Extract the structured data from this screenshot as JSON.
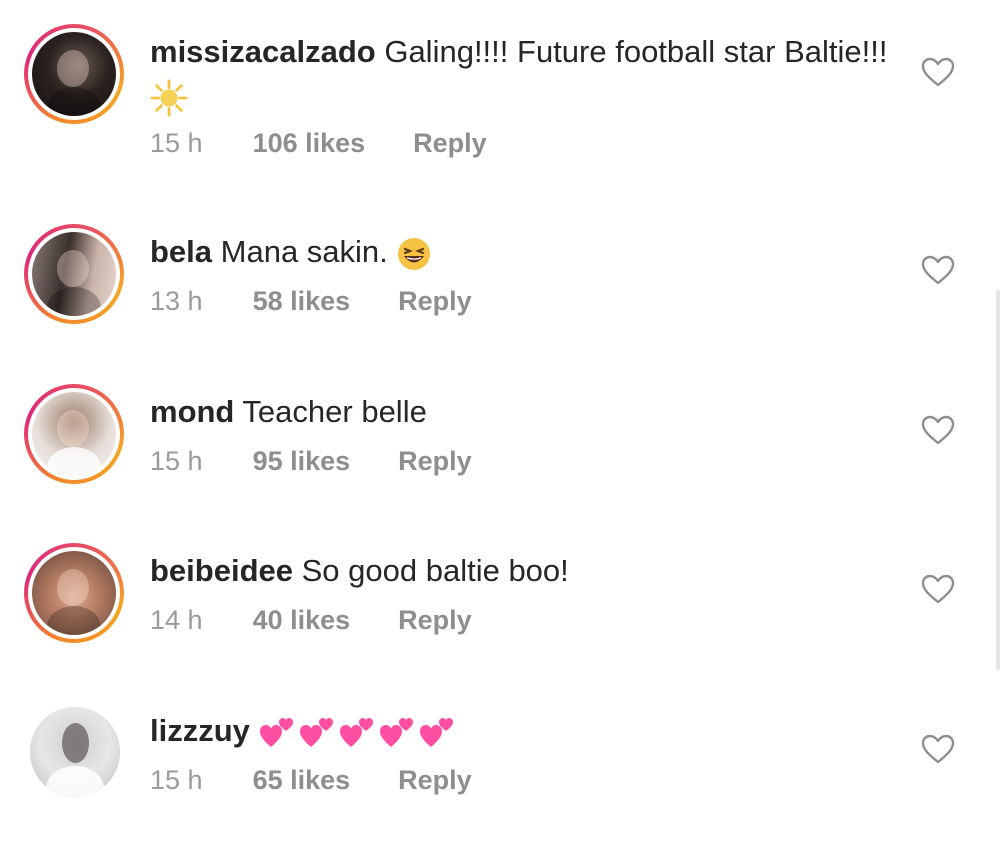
{
  "comments": [
    {
      "username": "missizacalzado",
      "text": " Galing!!!! Future football star Baltie!!! ",
      "emoji": "sun-emoji",
      "time": "15 h",
      "likes": "106 likes",
      "reply": "Reply",
      "avatar_ring": true
    },
    {
      "username": "bela",
      "text": " Mana sakin. ",
      "emoji": "laughing-emoji",
      "time": "13 h",
      "likes": "58 likes",
      "reply": "Reply",
      "avatar_ring": true
    },
    {
      "username": "mond",
      "text": " Teacher belle",
      "emoji": "",
      "time": "15 h",
      "likes": "95 likes",
      "reply": "Reply",
      "avatar_ring": true
    },
    {
      "username": "beibeidee",
      "text": " So good baltie boo!",
      "emoji": "",
      "time": "14 h",
      "likes": "40 likes",
      "reply": "Reply",
      "avatar_ring": true
    },
    {
      "username": "lizzzuy",
      "text": " ",
      "emoji": "two-hearts-emoji x5",
      "time": "15 h",
      "likes": "65 likes",
      "reply": "Reply",
      "avatar_ring": false
    }
  ],
  "colors": {
    "username": "#262626",
    "meta": "#8e8e8e",
    "ring_start": "#f58529",
    "ring_end": "#dd2a7b",
    "heart_emoji": "#ff4fa3"
  },
  "icons": {
    "like": "heart-outline-icon"
  }
}
